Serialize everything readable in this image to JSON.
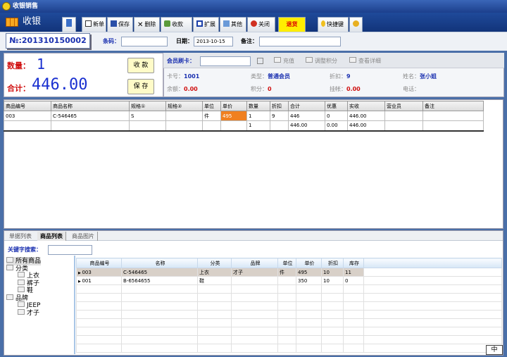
{
  "window": {
    "title": "收银销售"
  },
  "toolbar": {
    "app_name": "收银",
    "buttons": [
      {
        "label": "新单"
      },
      {
        "label": "保存"
      },
      {
        "label": "删除"
      },
      {
        "label": "收款"
      },
      {
        "label": "扩展"
      },
      {
        "label": "其他"
      },
      {
        "label": "关闭"
      }
    ],
    "refund": "退货",
    "shortcut": "快捷键"
  },
  "header": {
    "order_no": "№:201310150002",
    "barcode_label": "条码：",
    "barcode_value": "",
    "date_label": "日期：",
    "date_value": "2013-10-15",
    "note_label": "备注：",
    "note_value": ""
  },
  "summary": {
    "qty_label": "数量：",
    "qty_value": "1",
    "total_label": "合计：",
    "total_value": "446.00",
    "collect_btn": "收 款",
    "save_btn": "保 存"
  },
  "member": {
    "card_label": "会员刷卡：",
    "card_value": "",
    "recharge": "充值",
    "adjust_points": "调整积分",
    "view_detail": "查看详细",
    "card_no_label": "卡号：",
    "card_no": "1001",
    "type_label": "类型：",
    "type": "普通会员",
    "discount_label": "折扣：",
    "discount": "9",
    "name_label": "姓名：",
    "name": "张小姐",
    "balance_label": "余额：",
    "balance": "0.00",
    "points_label": "积分：",
    "points": "0",
    "credit_label": "挂帐：",
    "credit": "0.00",
    "phone_label": "电话：",
    "phone": ""
  },
  "sale_table": {
    "columns": [
      "商品编号",
      "商品名称",
      "规格①",
      "规格②",
      "单位",
      "单价",
      "数量",
      "折扣",
      "合计",
      "优惠",
      "实收",
      "营业员",
      "备注"
    ],
    "rows": [
      [
        "003",
        "C-546465",
        "S",
        "",
        "件",
        "495",
        "1",
        "9",
        "446",
        "0",
        "446.00",
        "",
        ""
      ]
    ],
    "totals": [
      "",
      "",
      "",
      "",
      "",
      "",
      "1",
      "",
      "446.00",
      "0.00",
      "446.00",
      "",
      ""
    ]
  },
  "bottom": {
    "tabs": [
      "单据列表",
      "商品列表",
      "商品图片"
    ],
    "search_label": "关键字搜索：",
    "search_value": "",
    "tree": [
      "所有商品",
      "分类",
      "上衣",
      "裤子",
      "鞋",
      "品牌",
      "JEEP",
      "才子"
    ],
    "product_table": {
      "columns": [
        "商品编号",
        "名称",
        "分类",
        "品牌",
        "单位",
        "单价",
        "折扣",
        "库存"
      ],
      "rows": [
        [
          "003",
          "C-546465",
          "上衣",
          "才子",
          "件",
          "495",
          "10",
          "11"
        ],
        [
          "001",
          "B-6564655",
          "鞋",
          "",
          "",
          "350",
          "10",
          "0"
        ]
      ]
    }
  },
  "ime": "中"
}
